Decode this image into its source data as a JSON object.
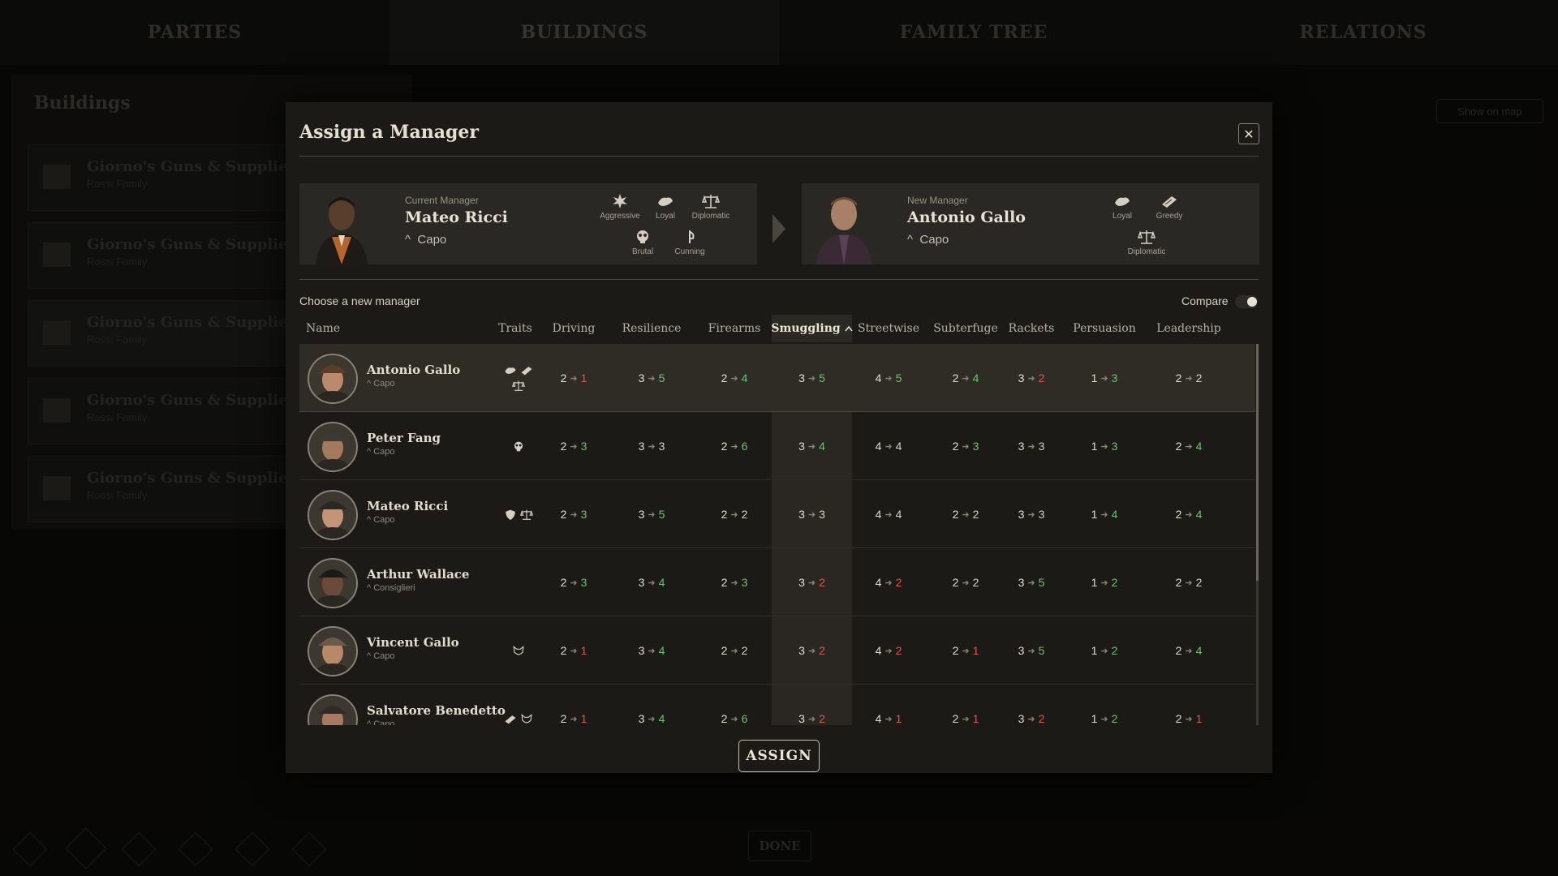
{
  "tabs": [
    "PARTIES",
    "BUILDINGS",
    "FAMILY TREE",
    "RELATIONS"
  ],
  "background": {
    "sidebar_title": "Buildings",
    "building_name": "Giorno's Guns & Supplies",
    "building_family": "Rossi Family",
    "show_on_map": "Show on map",
    "done_label": "DONE"
  },
  "modal": {
    "title": "Assign a Manager",
    "close": "✕",
    "current": {
      "label": "Current Manager",
      "name": "Mateo Ricci",
      "rank": "Capo",
      "traits": [
        {
          "label": "Aggressive",
          "icon": "aggressive-icon"
        },
        {
          "label": "Loyal",
          "icon": "loyal-icon"
        },
        {
          "label": "Diplomatic",
          "icon": "diplomatic-icon"
        },
        {
          "label": "Brutal",
          "icon": "brutal-icon"
        },
        {
          "label": "Cunning",
          "icon": "cunning-icon"
        }
      ]
    },
    "new": {
      "label": "New Manager",
      "name": "Antonio Gallo",
      "rank": "Capo",
      "traits": [
        {
          "label": "Loyal",
          "icon": "loyal-icon"
        },
        {
          "label": "Greedy",
          "icon": "greedy-icon"
        },
        {
          "label": "Diplomatic",
          "icon": "diplomatic-icon"
        }
      ]
    },
    "choose_label": "Choose a new manager",
    "compare_label": "Compare",
    "compare_on": true,
    "assign_label": "ASSIGN"
  },
  "table": {
    "columns": [
      "Name",
      "Traits",
      "Driving",
      "Resilience",
      "Firearms",
      "Smuggling",
      "Streetwise",
      "Subterfuge",
      "Rackets",
      "Persuasion",
      "Leadership"
    ],
    "sorted_column": "Smuggling",
    "sort_direction": "ascending",
    "rows": [
      {
        "name": "Antonio Gallo",
        "rank": "Capo",
        "traits": [
          "loyal-icon",
          "greedy-icon",
          "diplomatic-icon"
        ],
        "stats": [
          [
            2,
            1
          ],
          [
            3,
            5
          ],
          [
            2,
            4
          ],
          [
            3,
            5
          ],
          [
            4,
            5
          ],
          [
            2,
            4
          ],
          [
            3,
            2
          ],
          [
            1,
            3
          ],
          [
            2,
            2
          ]
        ]
      },
      {
        "name": "Peter Fang",
        "rank": "Capo",
        "traits": [
          "brutal-icon"
        ],
        "stats": [
          [
            2,
            3
          ],
          [
            3,
            3
          ],
          [
            2,
            6
          ],
          [
            3,
            4
          ],
          [
            4,
            4
          ],
          [
            2,
            3
          ],
          [
            3,
            3
          ],
          [
            1,
            3
          ],
          [
            2,
            4
          ]
        ]
      },
      {
        "name": "Mateo Ricci",
        "rank": "Capo",
        "traits": [
          "shield-icon",
          "diplomatic-icon"
        ],
        "stats": [
          [
            2,
            3
          ],
          [
            3,
            5
          ],
          [
            2,
            2
          ],
          [
            3,
            3
          ],
          [
            4,
            4
          ],
          [
            2,
            2
          ],
          [
            3,
            3
          ],
          [
            1,
            4
          ],
          [
            2,
            4
          ]
        ]
      },
      {
        "name": "Arthur Wallace",
        "rank": "Consiglieri",
        "traits": [],
        "stats": [
          [
            2,
            3
          ],
          [
            3,
            4
          ],
          [
            2,
            3
          ],
          [
            3,
            2
          ],
          [
            4,
            2
          ],
          [
            2,
            2
          ],
          [
            3,
            5
          ],
          [
            1,
            2
          ],
          [
            2,
            2
          ]
        ]
      },
      {
        "name": "Vincent Gallo",
        "rank": "Capo",
        "traits": [
          "wolf-icon"
        ],
        "stats": [
          [
            2,
            1
          ],
          [
            3,
            4
          ],
          [
            2,
            2
          ],
          [
            3,
            2
          ],
          [
            4,
            2
          ],
          [
            2,
            1
          ],
          [
            3,
            5
          ],
          [
            1,
            2
          ],
          [
            2,
            4
          ]
        ]
      },
      {
        "name": "Salvatore Benedetto",
        "rank": "Capo",
        "traits": [
          "greedy-icon",
          "wolf-icon"
        ],
        "stats": [
          [
            2,
            1
          ],
          [
            3,
            4
          ],
          [
            2,
            6
          ],
          [
            3,
            2
          ],
          [
            4,
            1
          ],
          [
            2,
            1
          ],
          [
            3,
            2
          ],
          [
            1,
            2
          ],
          [
            2,
            1
          ]
        ]
      }
    ]
  },
  "colors": {
    "up": "#6cc46a",
    "down": "#e0564a",
    "same": "#d8d1c2"
  }
}
